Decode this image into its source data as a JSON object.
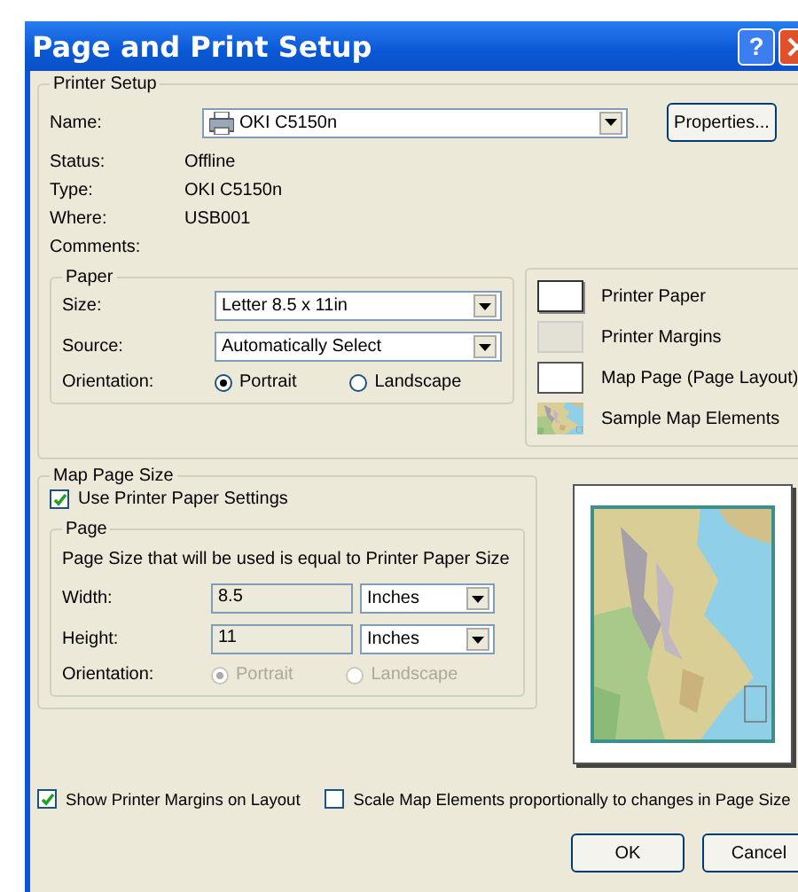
{
  "window": {
    "title": "Page and Print Setup",
    "help_button": "?"
  },
  "printer_setup": {
    "title": "Printer Setup",
    "name": {
      "label": "Name:",
      "value": "OKI C5150n"
    },
    "properties_button": "Properties...",
    "info": [
      {
        "label": "Status:",
        "value": "Offline"
      },
      {
        "label": "Type:",
        "value": "OKI C5150n"
      },
      {
        "label": "Where:",
        "value": "USB001"
      },
      {
        "label": "Comments:"
      }
    ]
  },
  "paper": {
    "title": "Paper",
    "size": {
      "label": "Size:",
      "value": "Letter 8.5 x 11in"
    },
    "source": {
      "label": "Source:",
      "value": "Automatically Select"
    },
    "orientation": {
      "label": "Orientation:",
      "disabled": false,
      "options": [
        {
          "label": "Portrait",
          "selected": true
        },
        {
          "label": "Landscape",
          "selected": false
        }
      ]
    }
  },
  "legend": [
    {
      "kind": "paper",
      "label": "Printer Paper"
    },
    {
      "kind": "margins",
      "label": "Printer Margins"
    },
    {
      "kind": "page",
      "label": "Map Page (Page Layout)"
    },
    {
      "kind": "elements",
      "label": "Sample Map Elements"
    }
  ],
  "map_page_size": {
    "title": "Map Page Size",
    "use_printer_paper": {
      "label": "Use Printer Paper Settings",
      "checked": true
    },
    "page": {
      "title": "Page",
      "note": "Page Size that will be used is equal to Printer Paper Size",
      "fields": [
        {
          "label": "Width:",
          "value": "8.5",
          "unit": "Inches",
          "disabled": true
        },
        {
          "label": "Height:",
          "value": "11",
          "unit": "Inches",
          "disabled": true
        }
      ],
      "orientation": {
        "label": "Orientation:",
        "disabled": true,
        "options": [
          {
            "label": "Portrait",
            "selected": true
          },
          {
            "label": "Landscape",
            "selected": false
          }
        ]
      }
    }
  },
  "options": [
    {
      "label": "Show Printer Margins on Layout",
      "checked": true
    },
    {
      "label": "Scale Map Elements proportionally to changes in Page Size",
      "checked": false
    }
  ],
  "buttons": [
    "OK",
    "Cancel"
  ]
}
